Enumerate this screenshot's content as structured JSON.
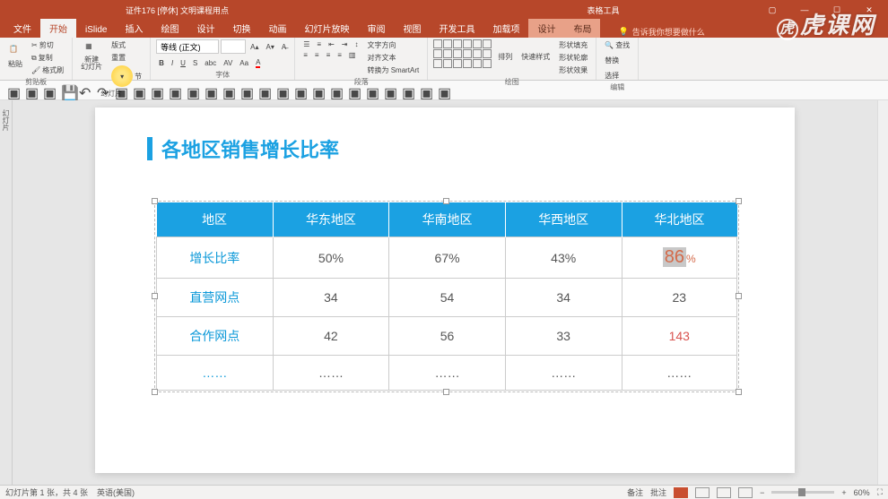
{
  "titlebar": {
    "filename": "证件176 [停休] 文明课程用点",
    "context_label": "表格工具"
  },
  "tabs": {
    "file": "文件",
    "home": "开始",
    "islide": "iSlide",
    "insert": "插入",
    "draw": "绘图",
    "design": "设计",
    "transitions": "切换",
    "animations": "动画",
    "slideshow": "幻灯片放映",
    "review": "审阅",
    "view": "视图",
    "developer": "开发工具",
    "addins": "加载项",
    "table_design": "设计",
    "table_layout": "布局",
    "search_placeholder": "告诉我你想要做什么"
  },
  "ribbon": {
    "clipboard": {
      "paste": "粘贴",
      "cut": "剪切",
      "copy": "复制",
      "format_painter": "格式刷",
      "label": "剪贴板"
    },
    "slides": {
      "new_slide": "新建\n幻灯片",
      "layout": "版式",
      "reset": "重置",
      "section": "节",
      "label": "幻灯片"
    },
    "font": {
      "name": "等线 (正文)",
      "size": "",
      "label": "字体"
    },
    "paragraph": {
      "text_direction": "文字方向",
      "align_text": "对齐文本",
      "smartart": "转换为 SmartArt",
      "label": "段落"
    },
    "drawing": {
      "arrange": "排列",
      "quick_styles": "快速样式",
      "shape_fill": "形状填充",
      "shape_outline": "形状轮廓",
      "shape_effects": "形状效果",
      "label": "绘图"
    },
    "editing": {
      "find": "查找",
      "replace": "替换",
      "select": "选择",
      "label": "编辑"
    }
  },
  "slide": {
    "title": "各地区销售增长比率",
    "table": {
      "headers": [
        "地区",
        "华东地区",
        "华南地区",
        "华西地区",
        "华北地区"
      ],
      "rows": [
        {
          "label": "增长比率",
          "cells": [
            "50%",
            "67%",
            "43%"
          ],
          "special": {
            "num": "86",
            "suffix": "%"
          }
        },
        {
          "label": "直营网点",
          "cells": [
            "34",
            "54",
            "34",
            "23"
          ]
        },
        {
          "label": "合作网点",
          "cells": [
            "42",
            "56",
            "33"
          ],
          "highlight": "143"
        },
        {
          "label": "……",
          "cells": [
            "……",
            "……",
            "……",
            "……"
          ]
        }
      ]
    }
  },
  "statusbar": {
    "slide_info": "幻灯片第 1 张，共 4 张",
    "language": "英语(美国)",
    "notes": "备注",
    "comments": "批注",
    "zoom": "60%"
  },
  "watermark": "虎课网"
}
